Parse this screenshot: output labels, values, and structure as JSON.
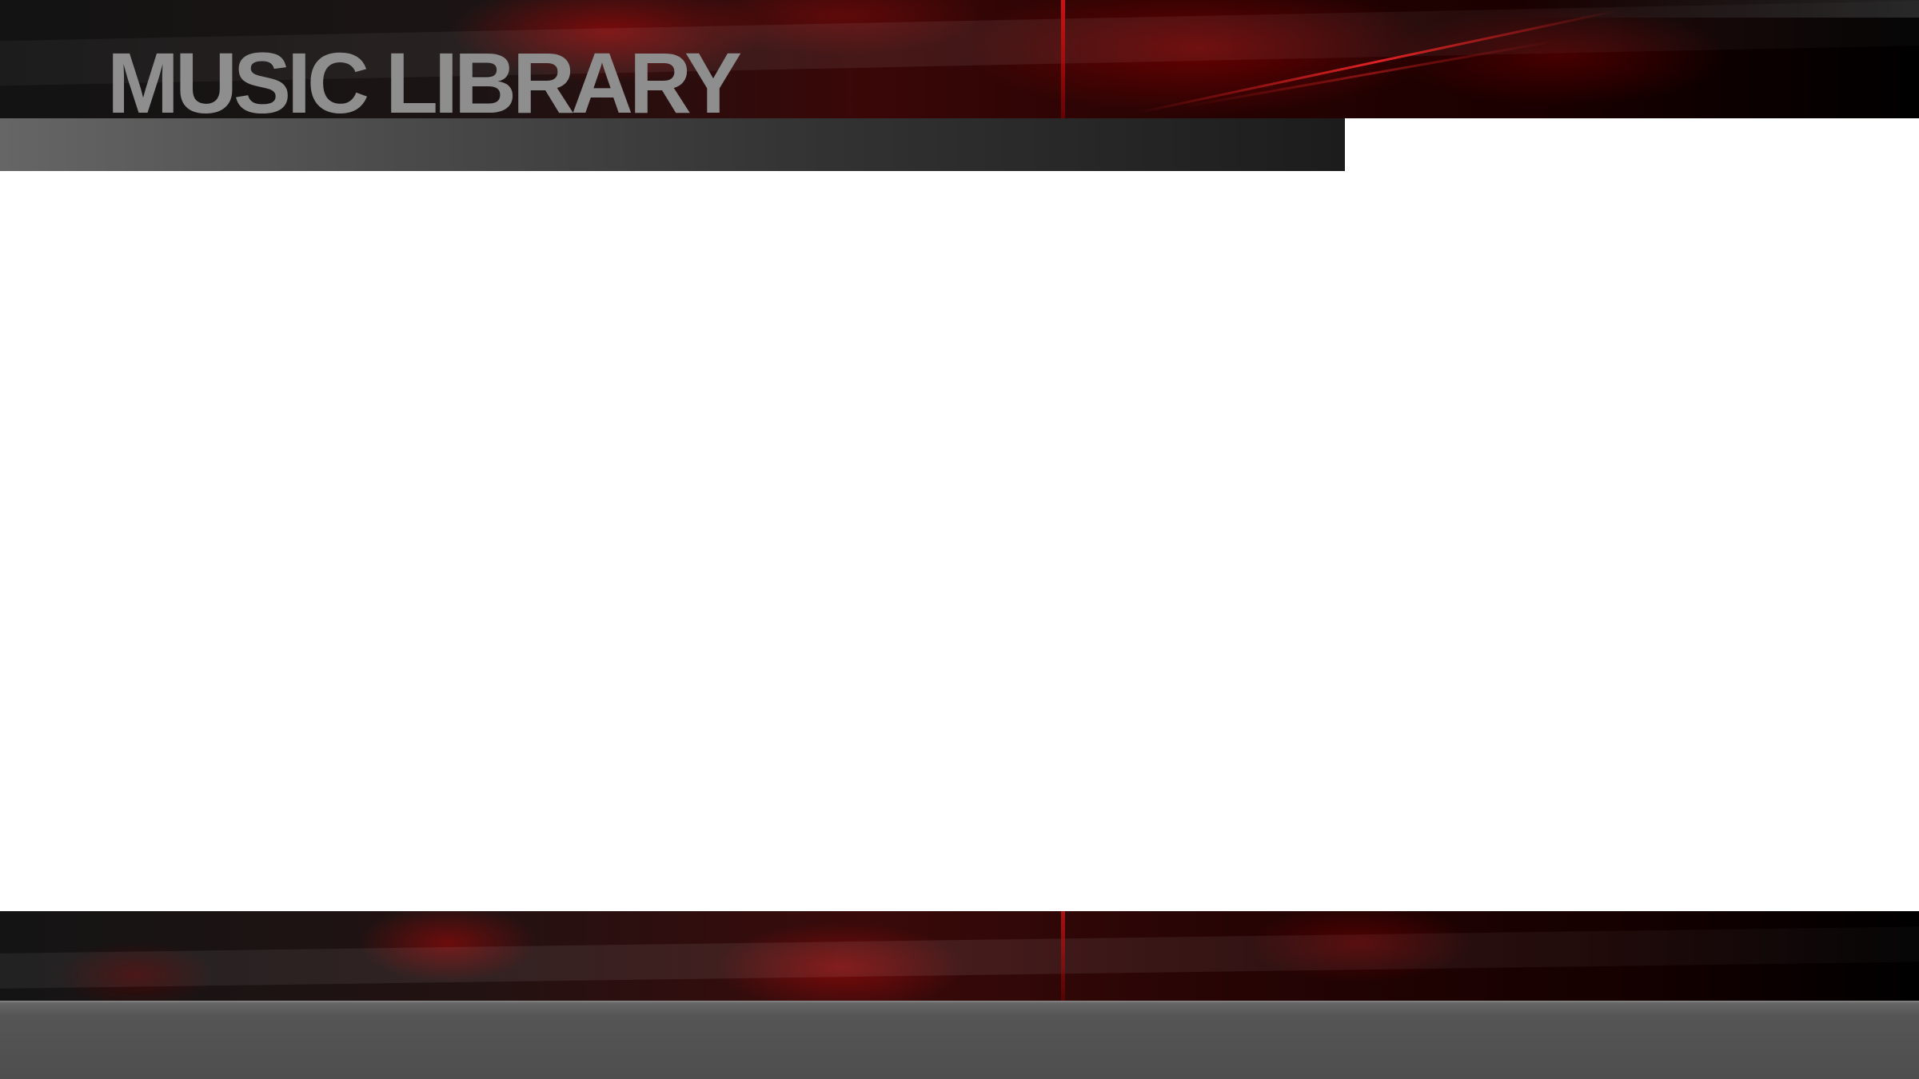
{
  "header": {
    "title": "MUSIC LIBRARY"
  },
  "theme": {
    "accent": "#8b0000",
    "title_color": "#8e8e8e",
    "subheader_start": "#666666",
    "subheader_end": "#1c1c1c",
    "background": "#ffffff",
    "bottom_bar": "#4e4e4e"
  }
}
